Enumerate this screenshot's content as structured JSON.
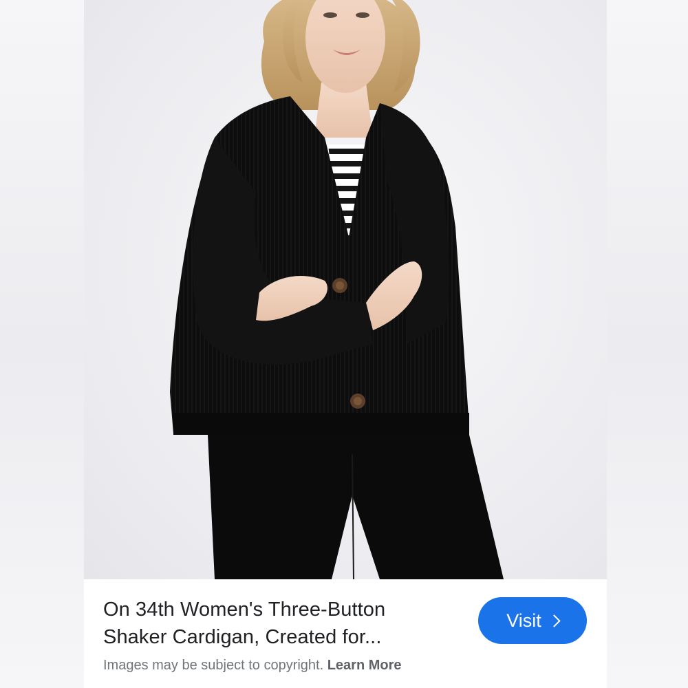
{
  "product": {
    "image_alt": "On 34th Women's Three-Button Shaker Cardigan",
    "title_line1": "On 34th Women's Three-Button",
    "title_line2": "Shaker Cardigan, Created for..."
  },
  "actions": {
    "visit_label": "Visit",
    "visit_icon": "chevron-right-icon"
  },
  "footer": {
    "copyright_text": "Images may be subject to copyright.",
    "learn_more_label": "Learn More"
  },
  "colors": {
    "accent": "#1a73e8",
    "title_text": "#202124",
    "muted_text": "#70757a"
  }
}
